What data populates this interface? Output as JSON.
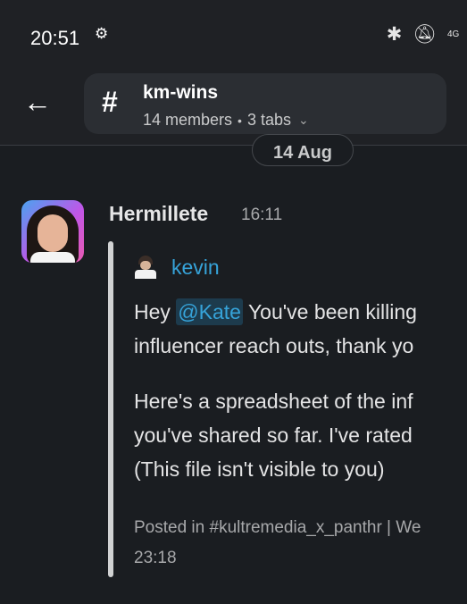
{
  "status_bar": {
    "time": "20:51",
    "icons": [
      "settings-gear",
      "bluetooth",
      "muted-bell",
      "4g-signal"
    ],
    "network": "4G"
  },
  "header": {
    "back_icon": "arrow-left",
    "channel_prefix": "#",
    "channel_name": "km-wins",
    "members": "14 members",
    "tabs": "3 tabs"
  },
  "date_divider": "14 Aug",
  "message": {
    "author": "Hermillete",
    "time": "16:11",
    "quoted": {
      "author": "kevin",
      "line1_before": "Hey ",
      "mention": "@Kate",
      "line1_after": " You've been killing",
      "line2": "influencer reach outs, thank yo",
      "line3": "Here's a spreadsheet of the inf",
      "line4": "you've shared so far. I've rated",
      "line5": "(This file isn't visible to you)",
      "posted_in": "Posted in #kultremedia_x_panthr | We",
      "posted_time": "23:18"
    }
  },
  "colors": {
    "background": "#1a1d21",
    "link": "#36a3d9",
    "mention_bg": "#1d3b4d"
  }
}
